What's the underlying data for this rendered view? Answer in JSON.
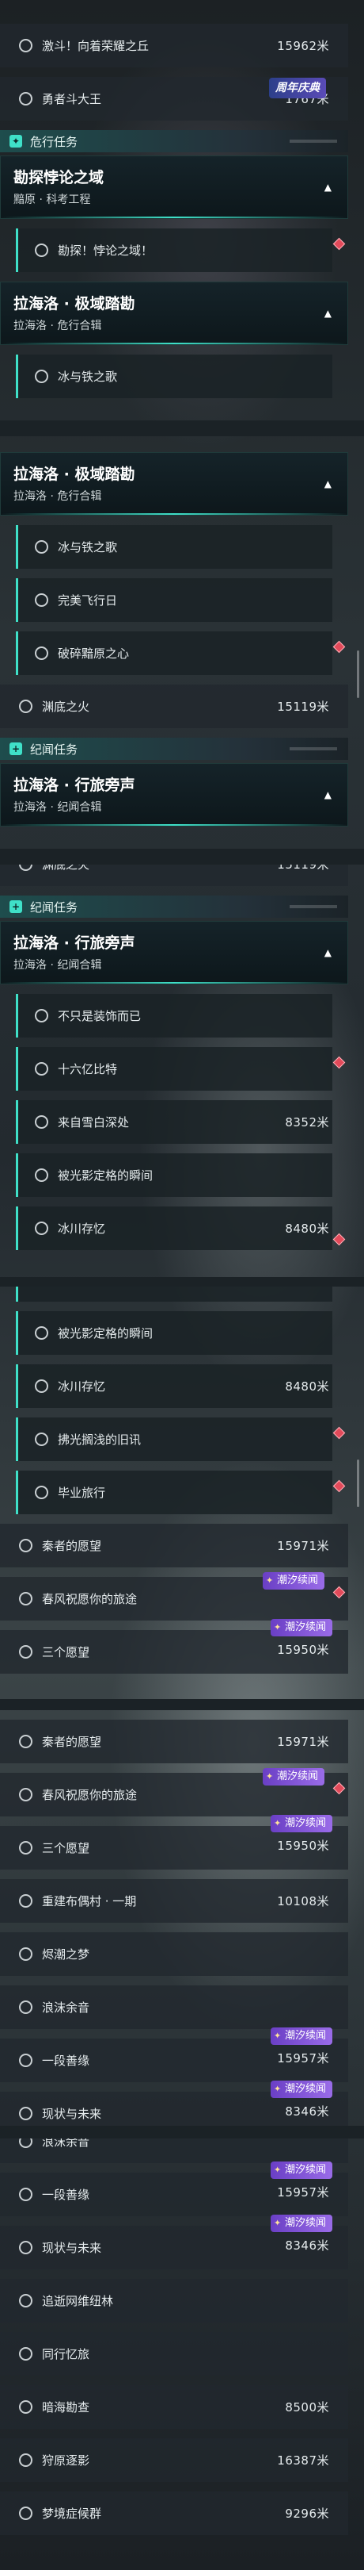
{
  "sections": {
    "danger_task": "危行任务",
    "legend_task": "纪闻任务"
  },
  "quests": {
    "battle": "激斗！向着荣耀之丘",
    "brave": "勇者斗大王",
    "explore_head_title": "勘探悖论之域",
    "explore_head_sub": "黯原 · 科考工程",
    "explore_sub": "勘探！悖论之域！",
    "lahai_polar_title": "拉海洛 · 极域踏勘",
    "lahai_polar_sub": "拉海洛 · 危行合辑",
    "iron": "冰与铁之歌",
    "perfect_flight": "完美飞行日",
    "broken_heart": "破碎黯原之心",
    "abyss_fire": "渊底之火",
    "lahai_walk_title": "拉海洛 · 行旅旁声",
    "lahai_walk_sub": "拉海洛 · 纪闻合辑",
    "not_decoration": "不只是装饰而已",
    "sixteen": "十六亿比特",
    "from_snow": "来自雪白深处",
    "frozen_moment": "被光影定格的瞬间",
    "ice_river": "冰川存忆",
    "skim_traces": "拂光搁浅的旧讯",
    "graduation": "毕业旅行",
    "qin_wish": "秦者的愿望",
    "spring_wind": "春风祝愿你的旅途",
    "three_wishes": "三个愿望",
    "rebuild": "重建布偶村 · 一期",
    "dream": "烬潮之梦",
    "waves": "浪沫余音",
    "flicker": "一段善缘",
    "present_future": "现状与未来",
    "chase": "追逝网维纽林",
    "together": "同行忆旅",
    "dark_sea": "暗海勘查",
    "ferry": "狩原逐影",
    "dream_syndrome": "梦境症候群"
  },
  "distances": {
    "battle": "15962米",
    "brave": "1767米",
    "abyss_fire": "15119米",
    "from_snow": "8352米",
    "ice_river": "8480米",
    "qin_wish": "15971米",
    "three_wishes": "15950米",
    "rebuild": "10108米",
    "flicker": "15957米",
    "present_future": "8346米",
    "dark_sea": "8500米",
    "ferry": "16387米",
    "dream_syndrome": "9296米"
  },
  "badges": {
    "tide": "潮汐续闻",
    "anniversary": "周年庆典"
  },
  "icons": {
    "collapse": "chevron-up-icon",
    "task_marker": "diamond-icon",
    "radio": "radio-circle-icon",
    "section": "plus-icon"
  },
  "colors": {
    "accent": "#3fe0c8",
    "badge": "#7b4fd6",
    "marker": "#e24a5a"
  }
}
